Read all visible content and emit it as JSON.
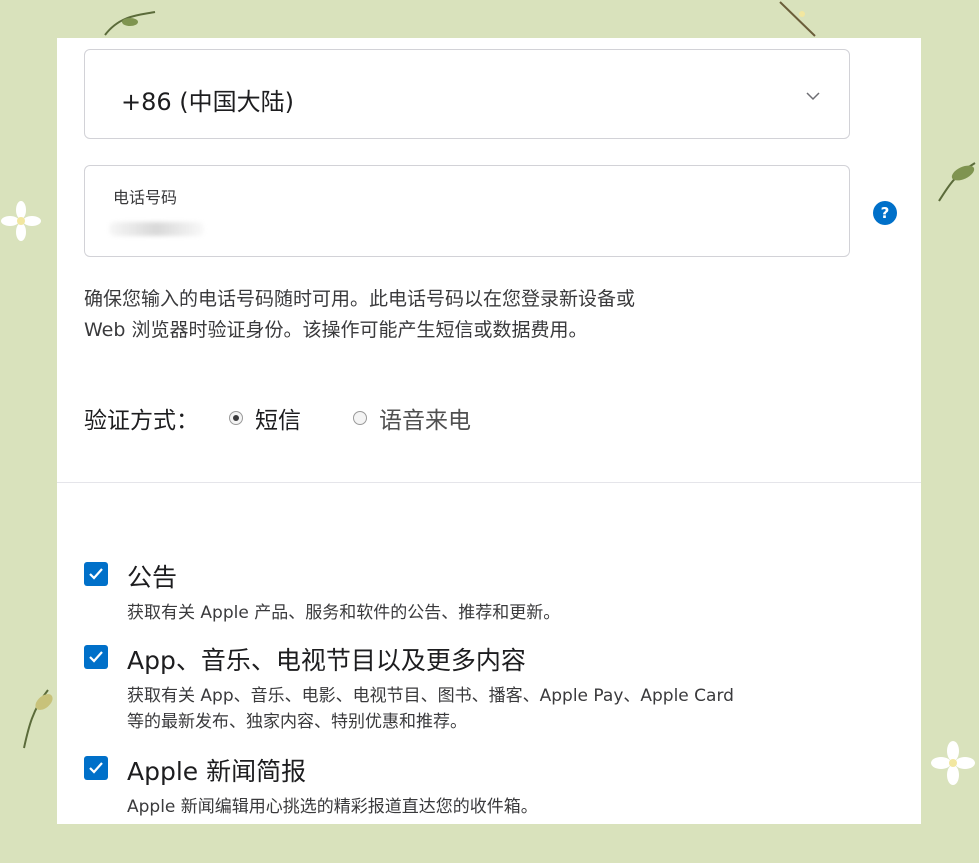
{
  "country_select": {
    "value": "+86 (中国大陆)"
  },
  "phone_field": {
    "label": "电话号码",
    "value_redacted": true
  },
  "help_icon_text": "?",
  "info_text": {
    "line1": "确保您输入的电话号码随时可用。此电话号码以在您登录新设备或",
    "line2": "Web 浏览器时验证身份。该操作可能产生短信或数据费用。"
  },
  "verification": {
    "label": "验证方式：",
    "options": [
      {
        "label": "短信",
        "selected": true
      },
      {
        "label": "语音来电",
        "selected": false
      }
    ]
  },
  "subscriptions": [
    {
      "title": "公告",
      "checked": true,
      "description": "获取有关 Apple 产品、服务和软件的公告、推荐和更新。"
    },
    {
      "title": "App、音乐、电视节目以及更多内容",
      "checked": true,
      "description_line1": "获取有关 App、音乐、电影、电视节目、图书、播客、Apple Pay、Apple Card",
      "description_line2": "等的最新发布、独家内容、特别优惠和推荐。"
    },
    {
      "title": "Apple 新闻简报",
      "checked": true,
      "description": "Apple 新闻编辑用心挑选的精彩报道直达您的收件箱。"
    }
  ],
  "colors": {
    "accent": "#0070c9",
    "background": "#d9e2bc",
    "panel": "#ffffff"
  }
}
